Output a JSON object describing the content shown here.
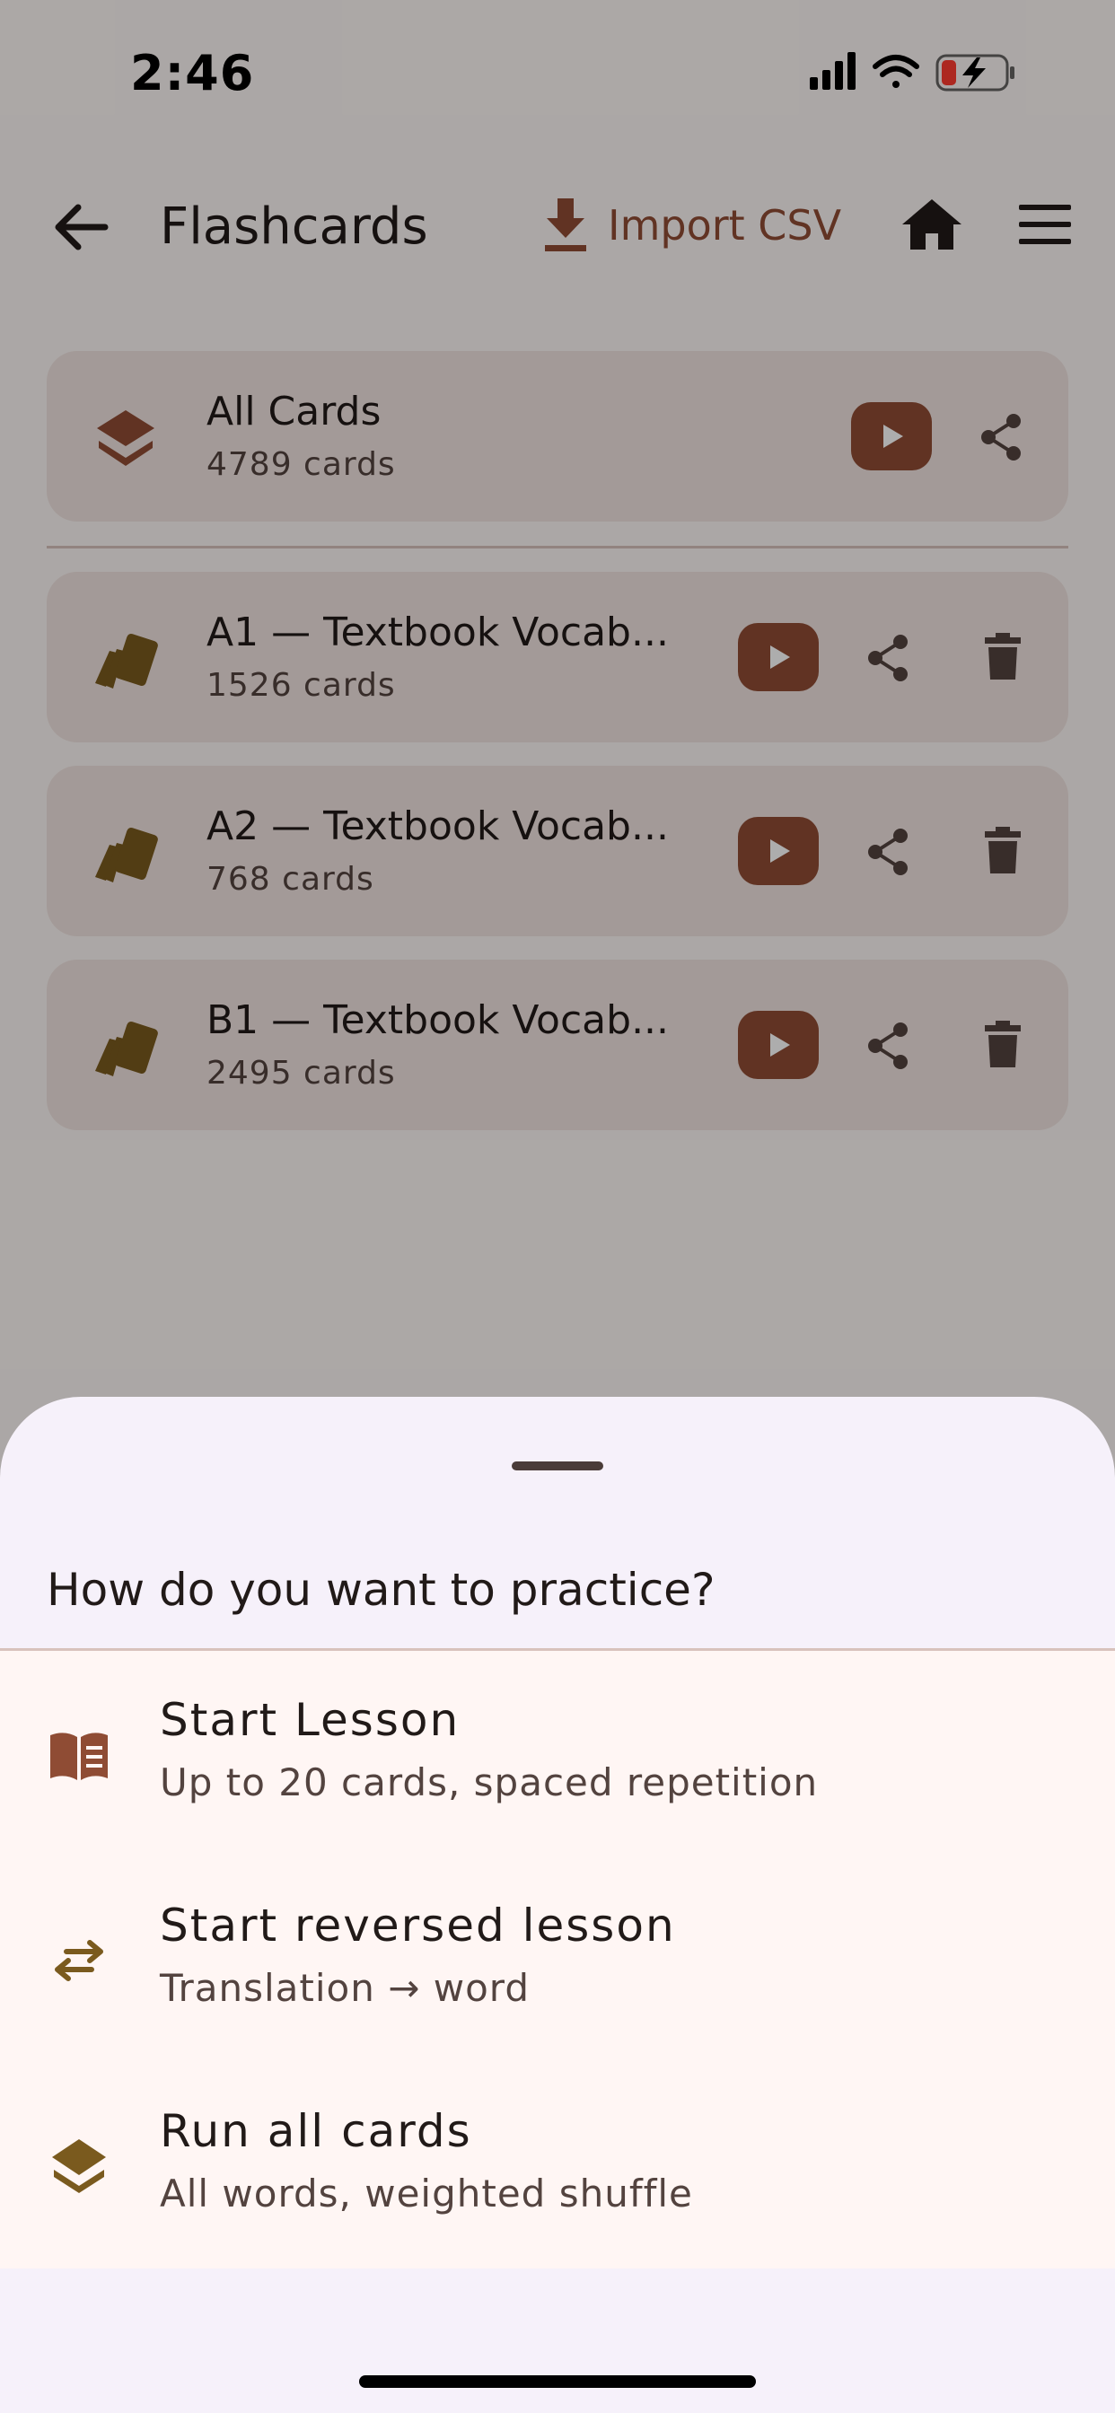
{
  "status_bar": {
    "time": "2:46"
  },
  "appbar": {
    "title": "Flashcards",
    "import_label": "Import CSV"
  },
  "all_cards": {
    "name": "All Cards",
    "count": "4789 cards"
  },
  "decks": [
    {
      "name": "A1 — Textbook Vocab...",
      "count": "1526 cards"
    },
    {
      "name": "A2 — Textbook Vocab...",
      "count": "768 cards"
    },
    {
      "name": "B1 — Textbook Vocab...",
      "count": "2495 cards"
    }
  ],
  "sheet": {
    "title": "How do you want to practice?",
    "options": [
      {
        "title": "Start Lesson",
        "subtitle": "Up to 20 cards, spaced repetition",
        "icon": "book-icon"
      },
      {
        "title": "Start reversed lesson",
        "subtitle": "Translation → word",
        "icon": "swap-arrows-icon"
      },
      {
        "title": "Run all cards",
        "subtitle": "All words, weighted shuffle",
        "icon": "layers-icon"
      }
    ]
  },
  "colors": {
    "accent": "#8f4c34",
    "deck_icon": "#7a5a1e",
    "sheet_bg": "#f6f1fa"
  }
}
